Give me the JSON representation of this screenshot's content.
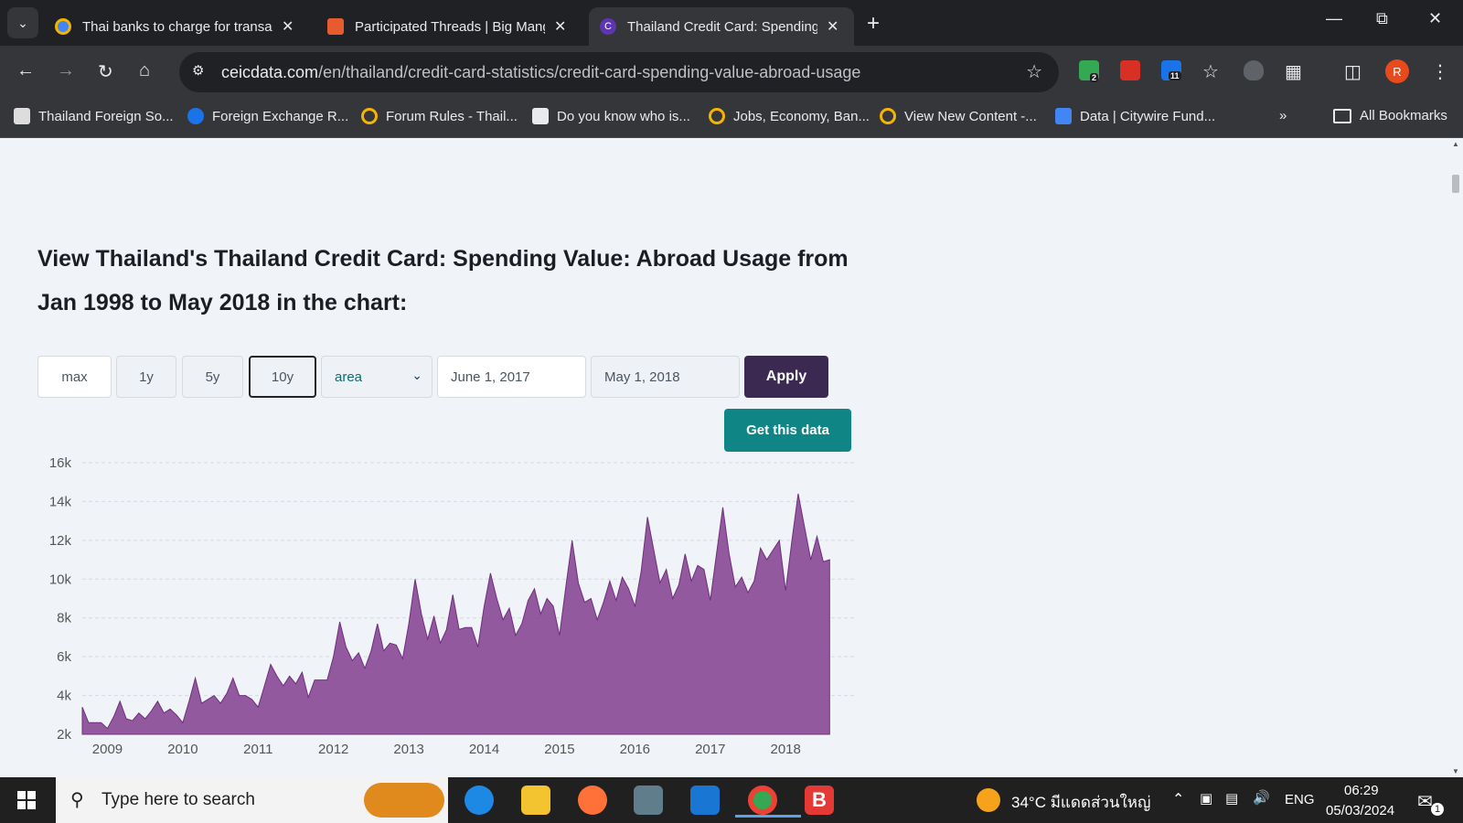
{
  "tabs": [
    {
      "title": "Thai banks to charge for transac",
      "color": "#f4b400"
    },
    {
      "title": "Participated Threads | Big Mang",
      "color": "#e65c2e"
    },
    {
      "title": "Thailand Credit Card: Spending",
      "color": "#5e35b1"
    }
  ],
  "address": {
    "domain": "ceicdata.com",
    "path": "/en/thailand/credit-card-statistics/credit-card-spending-value-abroad-usage"
  },
  "extensions": {
    "badge1": "2",
    "badge2": "11",
    "profile": "R"
  },
  "bookmarks": [
    "Thailand Foreign So...",
    "Foreign Exchange R...",
    "Forum Rules - Thail...",
    "Do you know who is...",
    "Jobs, Economy, Ban...",
    "View New Content -...",
    "Data | Citywire Fund..."
  ],
  "all_bookmarks": "All Bookmarks",
  "page": {
    "heading": "View Thailand's Thailand Credit Card: Spending Value: Abroad Usage from Jan 1998 to May 2018 in the chart:",
    "ranges": [
      "max",
      "1y",
      "5y",
      "10y"
    ],
    "selected_range": "10y",
    "chart_type_select": "area",
    "start_date": "June 1, 2017",
    "end_date": "May 1, 2018",
    "apply": "Apply",
    "get_data": "Get this data"
  },
  "chart_data": {
    "type": "area",
    "color": "#8b4b97",
    "y_ticks": [
      "16k",
      "14k",
      "12k",
      "10k",
      "8k",
      "6k",
      "4k",
      "2k"
    ],
    "ylim": [
      2000,
      16000
    ],
    "x_ticks": [
      "2009",
      "2010",
      "2011",
      "2012",
      "2013",
      "2014",
      "2015",
      "2016",
      "2017",
      "2018"
    ],
    "start": 2008.6667,
    "step": 0.0833333,
    "values": [
      3400,
      2600,
      2600,
      2600,
      2300,
      2900,
      3700,
      2800,
      2700,
      3100,
      2800,
      3200,
      3700,
      3100,
      3300,
      3000,
      2600,
      3700,
      4900,
      3600,
      3800,
      4000,
      3600,
      4100,
      4900,
      4000,
      4000,
      3800,
      3400,
      4500,
      5600,
      5000,
      4500,
      5000,
      4600,
      5200,
      3900,
      4800,
      4800,
      4800,
      6000,
      7800,
      6500,
      5800,
      6200,
      5400,
      6300,
      7700,
      6300,
      6700,
      6600,
      5900,
      7700,
      10000,
      8200,
      6900,
      8100,
      6700,
      7400,
      9200,
      7400,
      7500,
      7500,
      6500,
      8600,
      10300,
      9000,
      7900,
      8500,
      7100,
      7700,
      8900,
      9500,
      8200,
      9000,
      8600,
      7100,
      9600,
      12000,
      9800,
      8800,
      9000,
      7900,
      8800,
      9900,
      8900,
      10100,
      9500,
      8600,
      10400,
      13200,
      11500,
      9800,
      10500,
      9000,
      9700,
      11300,
      9900,
      10700,
      10500,
      8900,
      11300,
      13700,
      11300,
      9600,
      10100,
      9300,
      9900,
      11600,
      11000,
      11500,
      12000,
      9400,
      12000,
      14400,
      12700,
      11000,
      12200,
      10900,
      11000
    ]
  },
  "taskbar": {
    "search_placeholder": "Type here to search",
    "weather": "34°C มีแดดส่วนใหญ่",
    "language": "ENG",
    "time": "06:29",
    "date": "05/03/2024",
    "notifications": "1"
  }
}
